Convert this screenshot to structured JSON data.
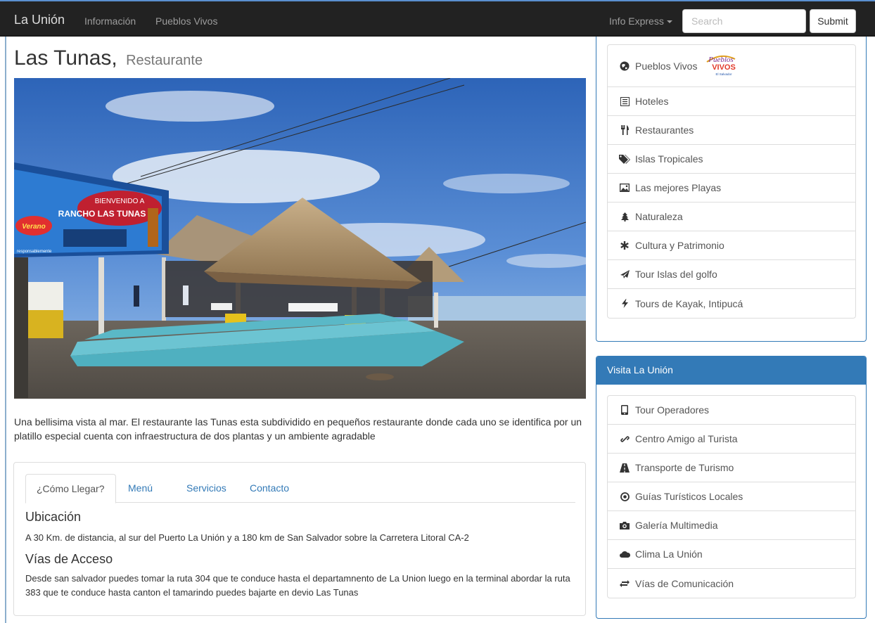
{
  "navbar": {
    "brand": "La Unión",
    "links": [
      "Información",
      "Pueblos Vivos"
    ],
    "dropdown_label": "Info Express",
    "search_placeholder": "Search",
    "submit_label": "Submit"
  },
  "page": {
    "title": "Las Tunas,",
    "subtitle": "Restaurante",
    "description": "Una bellisima vista al mar. El restaurante las Tunas esta subdividido en pequeños restaurante donde cada uno se identifica por un platillo especial cuenta con infraestructura de dos plantas y un ambiente agradable"
  },
  "photo": {
    "sign_line1": "BIENVENIDO A",
    "sign_line2": "RANCHO LAS TUNAS",
    "sign_brand": "Verano",
    "sign_note": "responsablemente"
  },
  "tabs": {
    "items": [
      "¿Cómo Llegar?",
      "Menú",
      "Servicios",
      "Contacto"
    ],
    "active_index": 0
  },
  "content": {
    "ubicacion_title": "Ubicación",
    "ubicacion_text": "A 30 Km. de distancia, al sur del Puerto La Unión y a 180 km de San Salvador sobre la Carretera Litoral CA-2",
    "vias_title": "Vías de Acceso",
    "vias_text": "Desde san salvador puedes tomar la ruta 304 que te conduce hasta el departamnento de La Union luego en la terminal abordar la ruta 383 que te conduce hasta canton el tamarindo puedes bajarte en devio Las Tunas"
  },
  "sidebar1": {
    "items": [
      {
        "label": "Pueblos Vivos",
        "icon": "globe-icon"
      },
      {
        "label": "Hoteles",
        "icon": "list-alt-icon"
      },
      {
        "label": "Restaurantes",
        "icon": "cutlery-icon"
      },
      {
        "label": "Islas Tropicales",
        "icon": "tags-icon"
      },
      {
        "label": "Las mejores Playas",
        "icon": "picture-icon"
      },
      {
        "label": "Naturaleza",
        "icon": "tree-icon"
      },
      {
        "label": "Cultura y Patrimonio",
        "icon": "asterisk-icon"
      },
      {
        "label": "Tour Islas del golfo",
        "icon": "send-icon"
      },
      {
        "label": "Tours de Kayak, Intipucá",
        "icon": "flash-icon"
      }
    ],
    "logo_text_1": "Pueblos",
    "logo_text_2": "VIVOS",
    "logo_text_3": "El Salvador"
  },
  "sidebar2": {
    "heading": "Visita La Unión",
    "items": [
      {
        "label": "Tour Operadores",
        "icon": "phone-icon"
      },
      {
        "label": "Centro Amigo al Turista",
        "icon": "link-icon"
      },
      {
        "label": "Transporte de Turismo",
        "icon": "road-icon"
      },
      {
        "label": "Guías Turísticos Locales",
        "icon": "record-icon"
      },
      {
        "label": "Galería Multimedia",
        "icon": "camera-icon"
      },
      {
        "label": "Clima La Unión",
        "icon": "cloud-icon"
      },
      {
        "label": "Vías de Comunicación",
        "icon": "transfer-icon"
      }
    ]
  },
  "colors": {
    "navbar_bg": "#222222",
    "link_blue": "#337ab7",
    "panel_heading": "#337ab7"
  }
}
